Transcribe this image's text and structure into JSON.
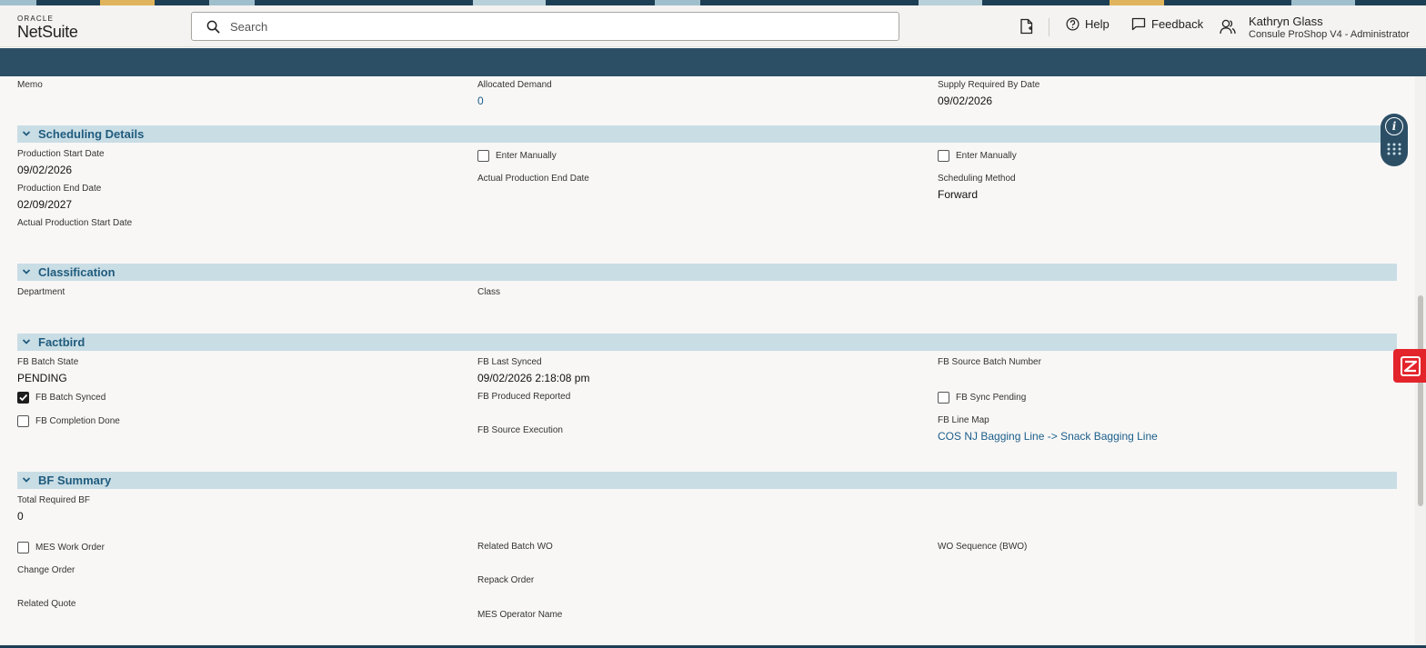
{
  "header": {
    "logo_top": "ORACLE",
    "logo_main": "NetSuite",
    "search_placeholder": "Search",
    "help_label": "Help",
    "feedback_label": "Feedback",
    "user_name": "Kathryn Glass",
    "user_role": "Consule ProShop V4 - Administrator"
  },
  "top_fields": {
    "memo_label": "Memo",
    "allocated_demand_label": "Allocated Demand",
    "allocated_demand_value": "0",
    "supply_required_label": "Supply Required By Date",
    "supply_required_value": "09/02/2026"
  },
  "scheduling": {
    "title": "Scheduling Details",
    "production_start_label": "Production Start Date",
    "production_start_value": "09/02/2026",
    "production_end_label": "Production End Date",
    "production_end_value": "02/09/2027",
    "actual_start_label": "Actual Production Start Date",
    "enter_manually_1": "Enter Manually",
    "actual_end_label": "Actual Production End Date",
    "enter_manually_2": "Enter Manually",
    "scheduling_method_label": "Scheduling Method",
    "scheduling_method_value": "Forward"
  },
  "classification": {
    "title": "Classification",
    "department_label": "Department",
    "class_label": "Class"
  },
  "factbird": {
    "title": "Factbird",
    "batch_state_label": "FB Batch State",
    "batch_state_value": "PENDING",
    "batch_synced_label": "FB Batch Synced",
    "batch_synced_checked": true,
    "completion_done_label": "FB Completion Done",
    "last_synced_label": "FB Last Synced",
    "last_synced_value": "09/02/2026 2:18:08 pm",
    "produced_reported_label": "FB Produced Reported",
    "source_execution_label": "FB Source Execution",
    "source_batch_label": "FB Source Batch Number",
    "sync_pending_label": "FB Sync Pending",
    "line_map_label": "FB Line Map",
    "line_map_value": "COS NJ Bagging Line -> Snack Bagging Line"
  },
  "bf_summary": {
    "title": "BF Summary",
    "total_required_label": "Total Required BF",
    "total_required_value": "0",
    "mes_work_order_label": "MES Work Order",
    "change_order_label": "Change Order",
    "related_quote_label": "Related Quote",
    "related_batch_label": "Related Batch WO",
    "repack_order_label": "Repack Order",
    "mes_operator_label": "MES Operator Name",
    "wo_sequence_label": "WO Sequence (BWO)"
  },
  "colors": {
    "nav_blue": "#2c4f66",
    "section_band": "#c9dde5",
    "section_title": "#1f5b7d",
    "link": "#1b5e8a",
    "accent_red": "#e3242b"
  }
}
